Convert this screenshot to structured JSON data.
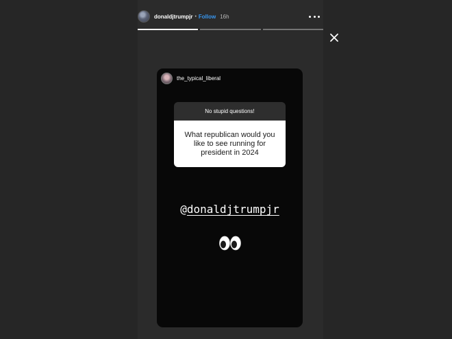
{
  "header": {
    "username": "donaldjtrumpjr",
    "separator": "•",
    "follow_label": "Follow",
    "timestamp": "16h",
    "more_icon": "more-horizontal-icon"
  },
  "progress": {
    "segments": [
      {
        "fill": 1.0
      },
      {
        "fill": 0.0
      },
      {
        "fill": 0.0
      }
    ]
  },
  "close_icon": "close-icon",
  "story": {
    "reply_username": "the_typical_liberal",
    "question_header": "No stupid questions!",
    "question_text": "What republican would you like to see running for president in 2024",
    "mention_at": "@",
    "mention_handle": "donaldjtrumpjr",
    "sticker": "eyes-emoji"
  },
  "colors": {
    "background": "#262626",
    "story_card": "#080808",
    "follow": "#3897f0",
    "question_header_bg": "#2e2e2e"
  }
}
